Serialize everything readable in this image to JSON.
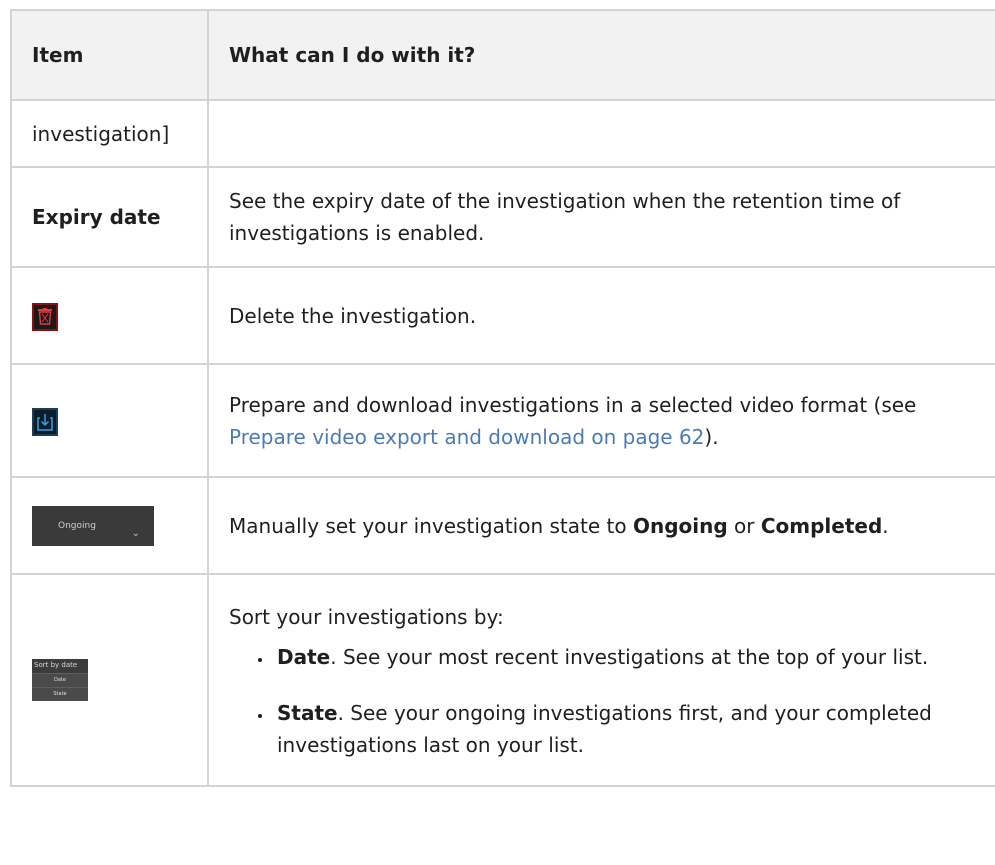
{
  "table": {
    "headers": {
      "item": "Item",
      "action": "What can I do with it?"
    },
    "rows": {
      "continuation": {
        "item": "investigation]",
        "desc": ""
      },
      "expiry": {
        "item": "Expiry date",
        "desc": "See the expiry date of the investigation when the retention time of investigations is enabled."
      },
      "delete": {
        "icon": "trash-icon",
        "desc": "Delete the investigation."
      },
      "download": {
        "icon": "download-icon",
        "desc_before": "Prepare and download investigations in a selected video format (see ",
        "link": "Prepare video export and download on page 62",
        "desc_after": ")."
      },
      "state": {
        "dropdown_value": "Ongoing",
        "desc_before": "Manually set your investigation state to ",
        "ongoing": "Ongoing",
        "or": " or ",
        "completed": "Completed",
        "desc_after": "."
      },
      "sort": {
        "widget_header": "Sort by date",
        "widget_options": [
          "Date",
          "State"
        ],
        "intro": "Sort your investigations by:",
        "items": [
          {
            "term": "Date",
            "text": ". See your most recent investigations at the top of your list."
          },
          {
            "term": "State",
            "text": ". See your ongoing investigations first, and your completed investigations last on your list."
          }
        ]
      }
    }
  },
  "colors": {
    "link": "#4a7bb7",
    "header_bg": "#f2f2f2",
    "border": "#d3d3d3"
  }
}
